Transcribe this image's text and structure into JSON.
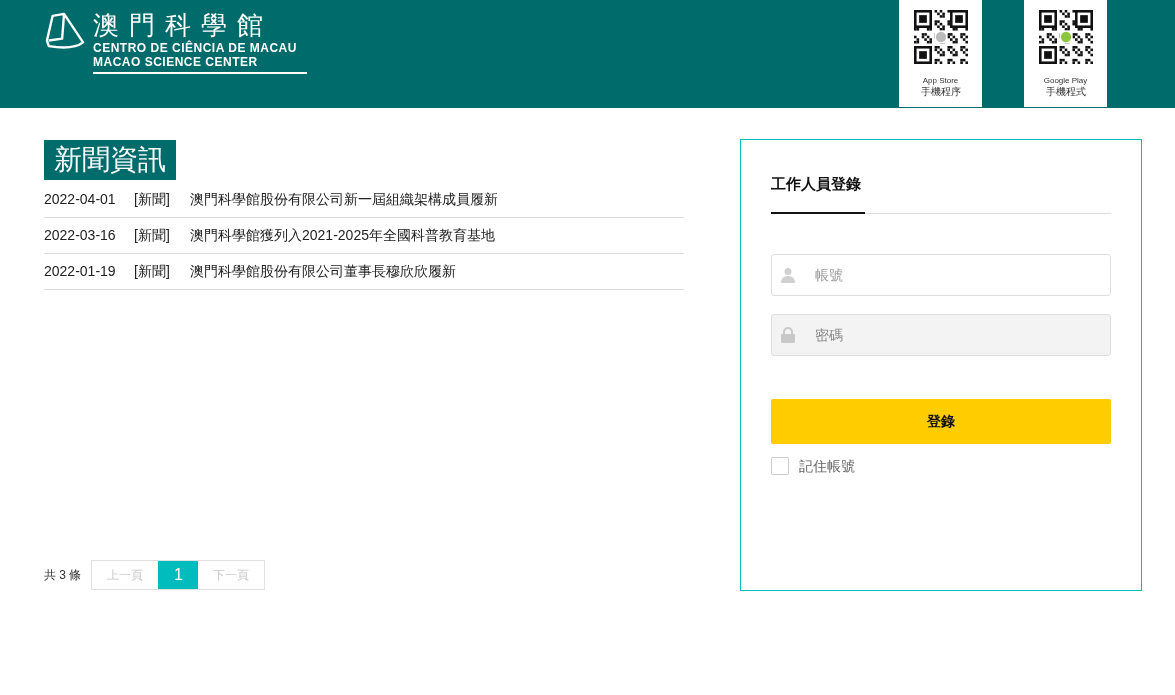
{
  "header": {
    "logo": {
      "title": "澳門科學館",
      "subtitle_pt": "CENTRO DE CIÊNCIA DE MACAU",
      "subtitle_en": "MACAO SCIENCE CENTER"
    },
    "app_codes": [
      {
        "store": "App Store",
        "caption": "手機程序",
        "kind": "apple"
      },
      {
        "store": "Google Play",
        "caption": "手機程式",
        "kind": "android"
      }
    ]
  },
  "news": {
    "heading": "新聞資訊",
    "items": [
      {
        "date": "2022-04-01",
        "category": "[新聞]",
        "title": "澳門科學館股份有限公司新一屆組織架構成員履新"
      },
      {
        "date": "2022-03-16",
        "category": "[新聞]",
        "title": "澳門科學館獲列入2021-2025年全國科普教育基地"
      },
      {
        "date": "2022-01-19",
        "category": "[新聞]",
        "title": "澳門科學館股份有限公司董事長穆欣欣履新"
      }
    ],
    "pagination": {
      "total": "共 3 條",
      "prev": {
        "label": "上一頁",
        "disabled": true
      },
      "pages": [
        {
          "label": "1",
          "selected": true
        }
      ],
      "next": {
        "label": "下一頁",
        "disabled": true
      }
    }
  },
  "login": {
    "tab": "工作人員登錄",
    "username": {
      "placeholder": "帳號"
    },
    "password": {
      "placeholder": "密碼"
    },
    "submit": "登錄",
    "remember": {
      "label": "記住帳號",
      "checked": false
    }
  }
}
